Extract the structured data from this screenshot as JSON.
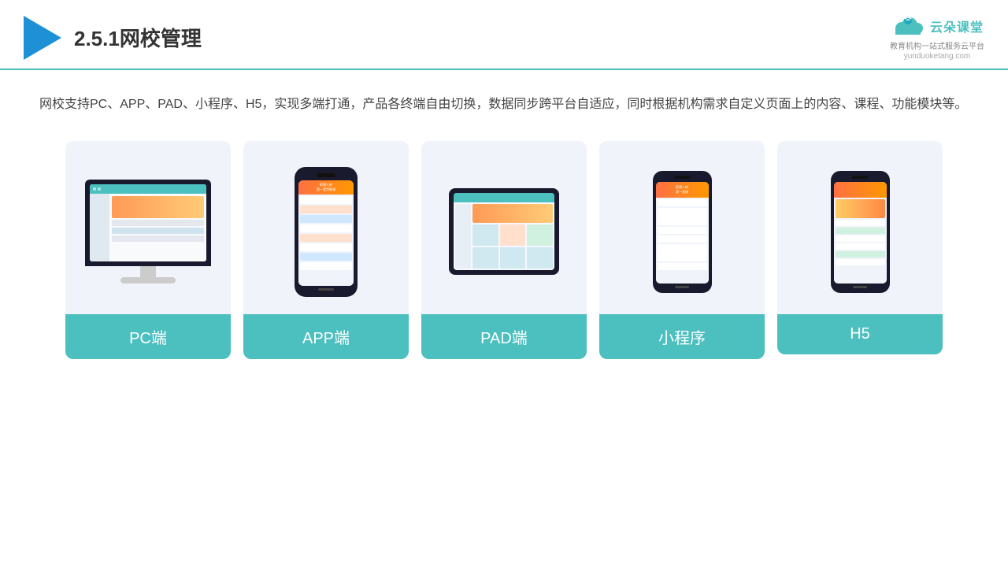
{
  "header": {
    "title": "2.5.1网校管理",
    "brand_name": "云朵课堂",
    "brand_url": "yunduoketang.com",
    "brand_tagline": "教育机构一站\n式服务云平台"
  },
  "description": "网校支持PC、APP、PAD、小程序、H5，实现多端打通，产品各终端自由切换，数据同步跨平台自适应，同时根据机构需求自定义页面上的内容、课程、功能模块等。",
  "cards": [
    {
      "id": "pc",
      "label": "PC端"
    },
    {
      "id": "app",
      "label": "APP端"
    },
    {
      "id": "pad",
      "label": "PAD端"
    },
    {
      "id": "miniprogram",
      "label": "小程序"
    },
    {
      "id": "h5",
      "label": "H5"
    }
  ],
  "colors": {
    "teal": "#4CBFBF",
    "dark_blue": "#1E90D5",
    "text_dark": "#333",
    "text_mid": "#444",
    "bg_card": "#f0f4fa"
  }
}
